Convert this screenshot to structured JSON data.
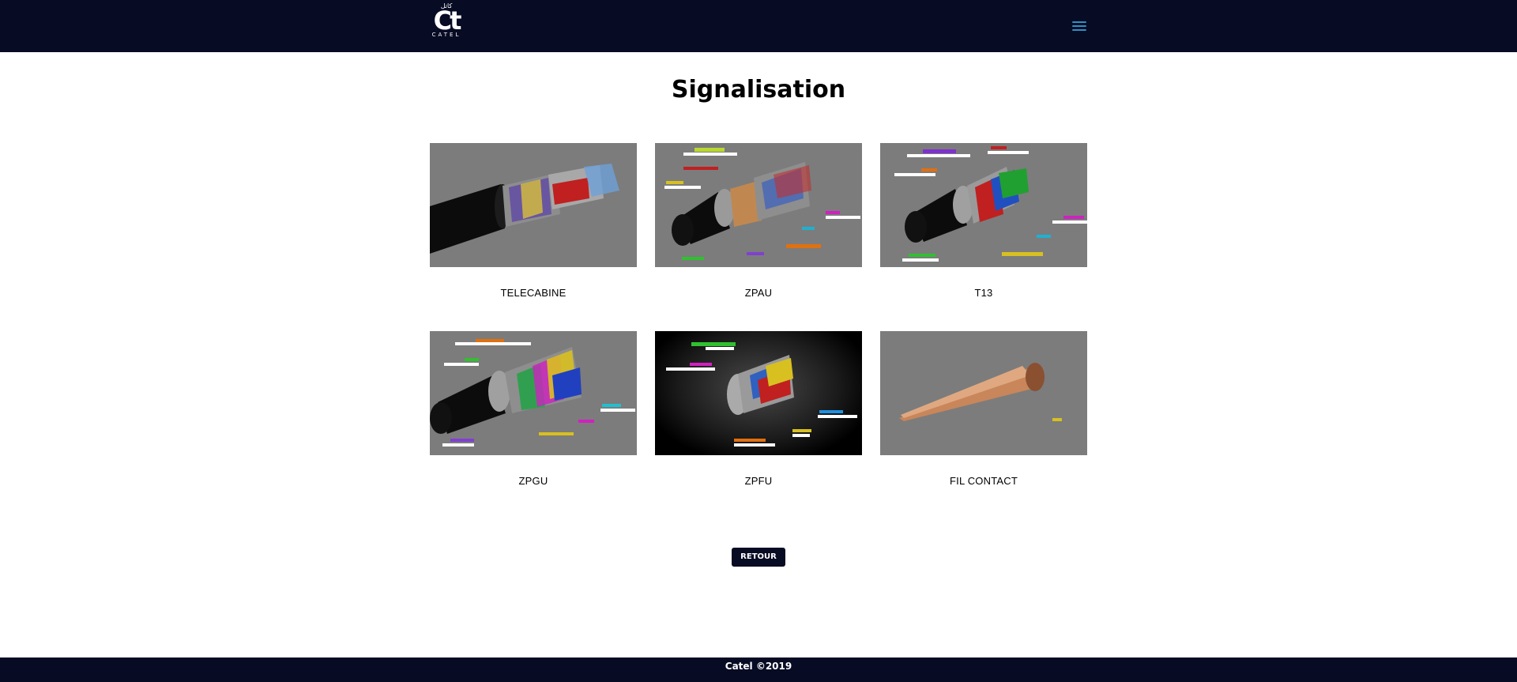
{
  "header": {
    "logo": {
      "arabic": "كاتل",
      "mark": "Ct",
      "brand": "CATEL"
    },
    "menu_icon": "hamburger-menu-icon"
  },
  "page": {
    "title": "Signalisation"
  },
  "products": [
    {
      "label": "TELECABINE"
    },
    {
      "label": "ZPAU"
    },
    {
      "label": "T13"
    },
    {
      "label": "ZPGU"
    },
    {
      "label": "ZPFU"
    },
    {
      "label": "FIL CONTACT"
    }
  ],
  "actions": {
    "back_label": "RETOUR"
  },
  "footer": {
    "copyright": "Catel ©2019"
  },
  "colors": {
    "navy": "#070b24",
    "menu_accent": "#2f8fc4",
    "thumb_grey": "#7c7c7c"
  }
}
